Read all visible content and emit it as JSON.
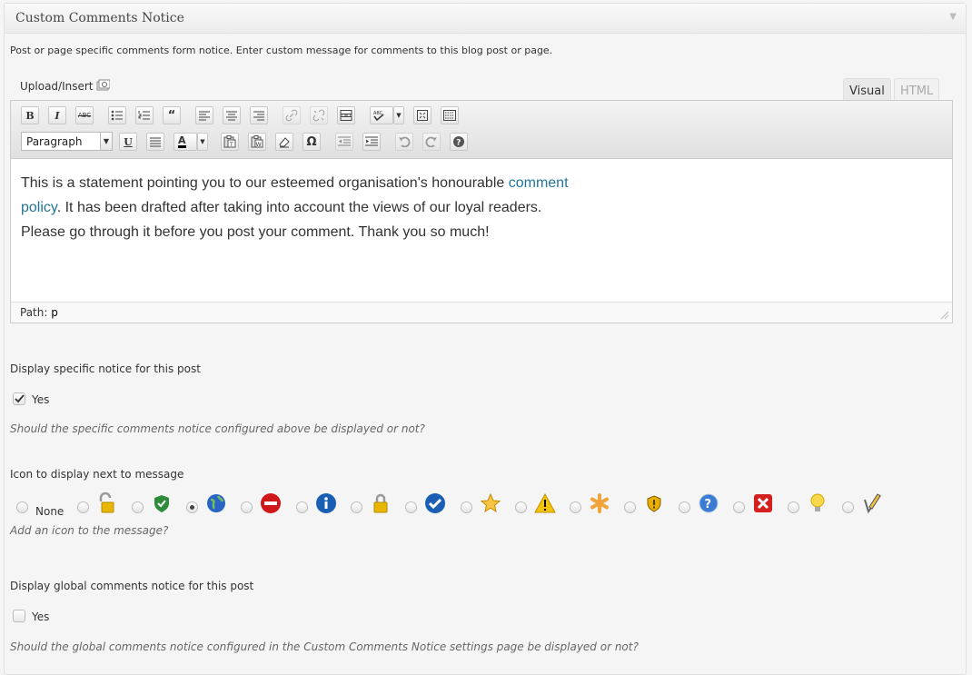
{
  "box": {
    "title": "Custom Comments Notice",
    "toggle_icon": "triangle-down-icon"
  },
  "description": "Post or page specific comments form notice. Enter custom message for comments to this blog post or page.",
  "editor": {
    "upload_label": "Upload/Insert",
    "tabs": [
      "Visual",
      "HTML"
    ],
    "active_tab": "Visual",
    "format_select": "Paragraph",
    "toolbar_row1": [
      "B",
      "I",
      "ABC",
      "bullet-list",
      "numbered-list",
      "blockquote",
      "align-left",
      "align-center",
      "align-right",
      "link",
      "unlink",
      "more",
      "spellcheck",
      "fullscreen",
      "kitchen-sink"
    ],
    "toolbar_row2": [
      "U",
      "justify",
      "A",
      "paste-text",
      "paste-word",
      "remove-format",
      "Ω",
      "outdent",
      "indent",
      "undo",
      "redo",
      "help"
    ],
    "content": {
      "part1": "This is a statement pointing you to our esteemed organisation's honourable ",
      "link1": "comment",
      "link2": "policy",
      "part2": ". It has been drafted after taking into account the views of our loyal readers.",
      "part3": "Please go through it before you post your comment. Thank you so much!",
      "link_color": "#21759b"
    },
    "path_label": "Path:",
    "path_value": "p"
  },
  "specific": {
    "label": "Display specific notice for this post",
    "checkbox_label": "Yes",
    "checked": true,
    "note": "Should the specific comments notice configured above be displayed or not?"
  },
  "icons": {
    "label": "Icon to display next to message",
    "none_label": "None",
    "note": "Add an icon to the message?",
    "selected_index": 3,
    "options": [
      "none",
      "unlocked-padlock-icon",
      "green-shield-check-icon",
      "globe-icon",
      "no-entry-icon",
      "info-icon",
      "padlock-icon",
      "blue-checkmark-icon",
      "star-icon",
      "warning-triangle-icon",
      "asterisk-icon",
      "shield-exclamation-icon",
      "help-question-icon",
      "red-x-icon",
      "lightbulb-icon",
      "pencil-icon"
    ]
  },
  "global": {
    "label": "Display global comments notice for this post",
    "checkbox_label": "Yes",
    "checked": false,
    "note": "Should the global comments notice configured in the Custom Comments Notice settings page be displayed or not?"
  }
}
